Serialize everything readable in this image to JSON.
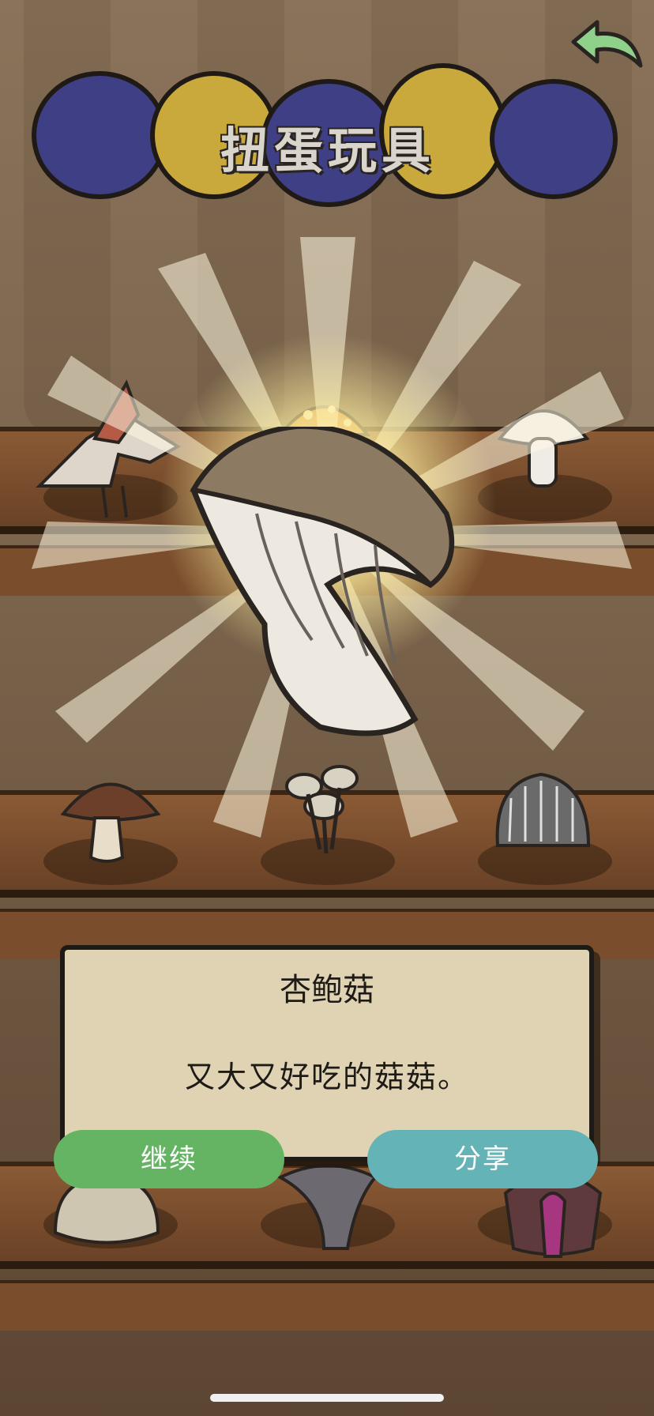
{
  "header": {
    "title": "扭蛋玩具",
    "back_icon": "back-arrow-icon"
  },
  "reward": {
    "name": "杏鲍菇",
    "description": "又大又好吃的菇菇。"
  },
  "buttons": {
    "continue_label": "继续",
    "share_label": "分享"
  },
  "shelf_items": [
    "pterodactyl-toy",
    "fly-agaric-mushroom",
    "white-button-mushroom",
    "shiitake-mushroom",
    "enoki-cluster",
    "lions-mane-mushroom",
    "morel-mushroom",
    "oyster-mushroom",
    "purple-tongue-mushroom"
  ],
  "colors": {
    "continue": "#65b463",
    "share": "#64b3b6",
    "card": "#dfd3b4",
    "capsule_blue": "#3f3f86",
    "capsule_yellow": "#c9a93c"
  }
}
